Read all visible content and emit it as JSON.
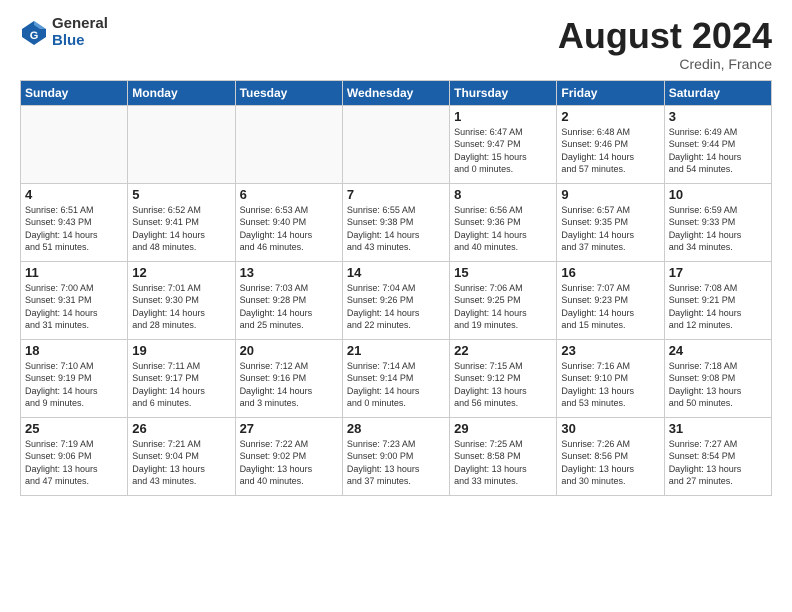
{
  "header": {
    "logo_general": "General",
    "logo_blue": "Blue",
    "month_title": "August 2024",
    "location": "Credin, France"
  },
  "weekdays": [
    "Sunday",
    "Monday",
    "Tuesday",
    "Wednesday",
    "Thursday",
    "Friday",
    "Saturday"
  ],
  "weeks": [
    [
      {
        "day": "",
        "detail": ""
      },
      {
        "day": "",
        "detail": ""
      },
      {
        "day": "",
        "detail": ""
      },
      {
        "day": "",
        "detail": ""
      },
      {
        "day": "1",
        "detail": "Sunrise: 6:47 AM\nSunset: 9:47 PM\nDaylight: 15 hours\nand 0 minutes."
      },
      {
        "day": "2",
        "detail": "Sunrise: 6:48 AM\nSunset: 9:46 PM\nDaylight: 14 hours\nand 57 minutes."
      },
      {
        "day": "3",
        "detail": "Sunrise: 6:49 AM\nSunset: 9:44 PM\nDaylight: 14 hours\nand 54 minutes."
      }
    ],
    [
      {
        "day": "4",
        "detail": "Sunrise: 6:51 AM\nSunset: 9:43 PM\nDaylight: 14 hours\nand 51 minutes."
      },
      {
        "day": "5",
        "detail": "Sunrise: 6:52 AM\nSunset: 9:41 PM\nDaylight: 14 hours\nand 48 minutes."
      },
      {
        "day": "6",
        "detail": "Sunrise: 6:53 AM\nSunset: 9:40 PM\nDaylight: 14 hours\nand 46 minutes."
      },
      {
        "day": "7",
        "detail": "Sunrise: 6:55 AM\nSunset: 9:38 PM\nDaylight: 14 hours\nand 43 minutes."
      },
      {
        "day": "8",
        "detail": "Sunrise: 6:56 AM\nSunset: 9:36 PM\nDaylight: 14 hours\nand 40 minutes."
      },
      {
        "day": "9",
        "detail": "Sunrise: 6:57 AM\nSunset: 9:35 PM\nDaylight: 14 hours\nand 37 minutes."
      },
      {
        "day": "10",
        "detail": "Sunrise: 6:59 AM\nSunset: 9:33 PM\nDaylight: 14 hours\nand 34 minutes."
      }
    ],
    [
      {
        "day": "11",
        "detail": "Sunrise: 7:00 AM\nSunset: 9:31 PM\nDaylight: 14 hours\nand 31 minutes."
      },
      {
        "day": "12",
        "detail": "Sunrise: 7:01 AM\nSunset: 9:30 PM\nDaylight: 14 hours\nand 28 minutes."
      },
      {
        "day": "13",
        "detail": "Sunrise: 7:03 AM\nSunset: 9:28 PM\nDaylight: 14 hours\nand 25 minutes."
      },
      {
        "day": "14",
        "detail": "Sunrise: 7:04 AM\nSunset: 9:26 PM\nDaylight: 14 hours\nand 22 minutes."
      },
      {
        "day": "15",
        "detail": "Sunrise: 7:06 AM\nSunset: 9:25 PM\nDaylight: 14 hours\nand 19 minutes."
      },
      {
        "day": "16",
        "detail": "Sunrise: 7:07 AM\nSunset: 9:23 PM\nDaylight: 14 hours\nand 15 minutes."
      },
      {
        "day": "17",
        "detail": "Sunrise: 7:08 AM\nSunset: 9:21 PM\nDaylight: 14 hours\nand 12 minutes."
      }
    ],
    [
      {
        "day": "18",
        "detail": "Sunrise: 7:10 AM\nSunset: 9:19 PM\nDaylight: 14 hours\nand 9 minutes."
      },
      {
        "day": "19",
        "detail": "Sunrise: 7:11 AM\nSunset: 9:17 PM\nDaylight: 14 hours\nand 6 minutes."
      },
      {
        "day": "20",
        "detail": "Sunrise: 7:12 AM\nSunset: 9:16 PM\nDaylight: 14 hours\nand 3 minutes."
      },
      {
        "day": "21",
        "detail": "Sunrise: 7:14 AM\nSunset: 9:14 PM\nDaylight: 14 hours\nand 0 minutes."
      },
      {
        "day": "22",
        "detail": "Sunrise: 7:15 AM\nSunset: 9:12 PM\nDaylight: 13 hours\nand 56 minutes."
      },
      {
        "day": "23",
        "detail": "Sunrise: 7:16 AM\nSunset: 9:10 PM\nDaylight: 13 hours\nand 53 minutes."
      },
      {
        "day": "24",
        "detail": "Sunrise: 7:18 AM\nSunset: 9:08 PM\nDaylight: 13 hours\nand 50 minutes."
      }
    ],
    [
      {
        "day": "25",
        "detail": "Sunrise: 7:19 AM\nSunset: 9:06 PM\nDaylight: 13 hours\nand 47 minutes."
      },
      {
        "day": "26",
        "detail": "Sunrise: 7:21 AM\nSunset: 9:04 PM\nDaylight: 13 hours\nand 43 minutes."
      },
      {
        "day": "27",
        "detail": "Sunrise: 7:22 AM\nSunset: 9:02 PM\nDaylight: 13 hours\nand 40 minutes."
      },
      {
        "day": "28",
        "detail": "Sunrise: 7:23 AM\nSunset: 9:00 PM\nDaylight: 13 hours\nand 37 minutes."
      },
      {
        "day": "29",
        "detail": "Sunrise: 7:25 AM\nSunset: 8:58 PM\nDaylight: 13 hours\nand 33 minutes."
      },
      {
        "day": "30",
        "detail": "Sunrise: 7:26 AM\nSunset: 8:56 PM\nDaylight: 13 hours\nand 30 minutes."
      },
      {
        "day": "31",
        "detail": "Sunrise: 7:27 AM\nSunset: 8:54 PM\nDaylight: 13 hours\nand 27 minutes."
      }
    ]
  ]
}
